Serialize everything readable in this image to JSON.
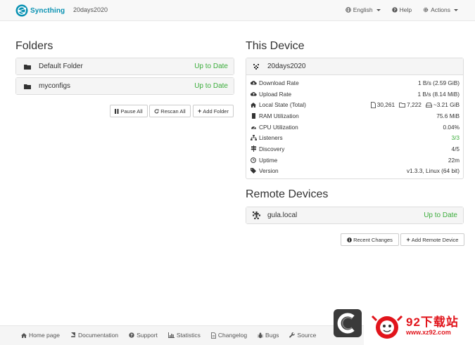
{
  "navbar": {
    "brand": "Syncthing",
    "device_name": "20days2020",
    "language": "English",
    "help": "Help",
    "actions": "Actions"
  },
  "folders": {
    "title": "Folders",
    "items": [
      {
        "label": "Default Folder",
        "status": "Up to Date"
      },
      {
        "label": "myconfigs",
        "status": "Up to Date"
      }
    ],
    "buttons": {
      "pause_all": "Pause All",
      "rescan_all": "Rescan All",
      "add_folder": "Add Folder"
    }
  },
  "this_device": {
    "title": "This Device",
    "name": "20days2020",
    "rows": [
      {
        "icon": "cloud-download-icon",
        "label": "Download Rate",
        "value": "1 B/s (2.59 GiB)"
      },
      {
        "icon": "cloud-upload-icon",
        "label": "Upload Rate",
        "value": "1 B/s (8.14 MiB)"
      },
      {
        "icon": "home-icon",
        "label": "Local State (Total)"
      },
      {
        "icon": "memory-icon",
        "label": "RAM Utilization",
        "value": "75.6 MiB"
      },
      {
        "icon": "cpu-icon",
        "label": "CPU Utilization",
        "value": "0.04%"
      },
      {
        "icon": "sitemap-icon",
        "label": "Listeners",
        "value": "3/3"
      },
      {
        "icon": "signpost-icon",
        "label": "Discovery",
        "value": "4/5"
      },
      {
        "icon": "clock-icon",
        "label": "Uptime",
        "value": "22m"
      },
      {
        "icon": "tag-icon",
        "label": "Version",
        "value": "v1.3.3, Linux (64 bit)"
      }
    ],
    "local_state": {
      "files": "30,261",
      "dirs": "7,222",
      "size": "~3.21 GiB"
    }
  },
  "remote_devices": {
    "title": "Remote Devices",
    "items": [
      {
        "label": "gula.local",
        "status": "Up to Date"
      }
    ],
    "buttons": {
      "recent_changes": "Recent Changes",
      "add_remote_device": "Add Remote Device"
    }
  },
  "footer": {
    "items": [
      "Home page",
      "Documentation",
      "Support",
      "Statistics",
      "Changelog",
      "Bugs",
      "Source"
    ]
  },
  "watermark": {
    "site_name": "92下载站",
    "url": "www.xz92.com"
  },
  "colors": {
    "accent": "#0891b2",
    "ok": "#3cad3c",
    "watermark": "#e1141b"
  }
}
